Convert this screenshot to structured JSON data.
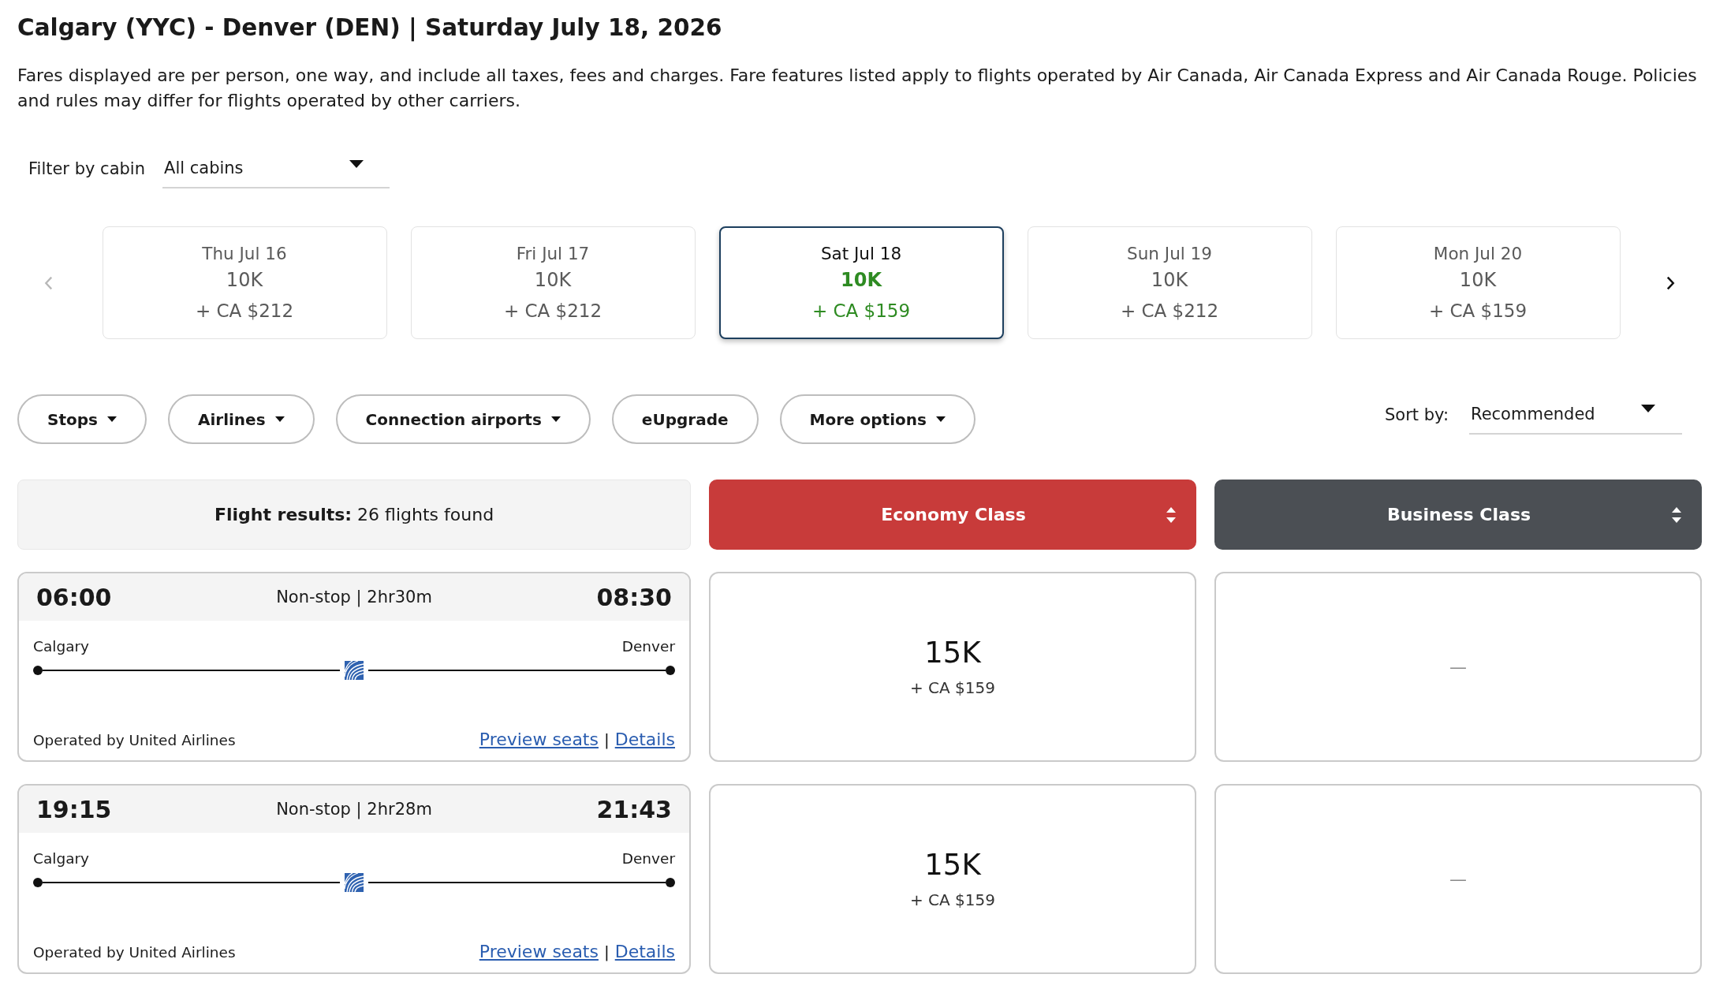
{
  "title": "Calgary (YYC) - Denver (DEN) | Saturday July 18, 2026",
  "notice": "Fares displayed are per person, one way, and include all taxes, fees and charges. Fare features listed apply to flights operated by Air Canada, Air Canada Express and Air Canada Rouge. Policies and rules may differ for flights operated by other carriers.",
  "cabin_filter": {
    "label": "Filter by cabin",
    "value": "All cabins"
  },
  "date_nav": {
    "previous": {
      "disabled": true
    },
    "next": {
      "disabled": false
    },
    "dates": [
      {
        "day": "Thu Jul 16",
        "points": "10K",
        "price": "+ CA $212",
        "selected": false
      },
      {
        "day": "Fri Jul 17",
        "points": "10K",
        "price": "+ CA $212",
        "selected": false
      },
      {
        "day": "Sat Jul 18",
        "points": "10K",
        "price": "+ CA $159",
        "selected": true
      },
      {
        "day": "Sun Jul 19",
        "points": "10K",
        "price": "+ CA $212",
        "selected": false
      },
      {
        "day": "Mon Jul 20",
        "points": "10K",
        "price": "+ CA $159",
        "selected": false
      }
    ]
  },
  "filters": [
    {
      "label": "Stops",
      "dropdown": true
    },
    {
      "label": "Airlines",
      "dropdown": true
    },
    {
      "label": "Connection airports",
      "dropdown": true
    },
    {
      "label": "eUpgrade",
      "dropdown": false
    },
    {
      "label": "More options",
      "dropdown": true
    }
  ],
  "sort": {
    "label": "Sort by:",
    "value": "Recommended"
  },
  "results_summary": "**Flight results:** 26 flights found",
  "cabins": [
    {
      "name": "Economy Class",
      "color": "#c83b3a"
    },
    {
      "name": "Business Class",
      "color": "#4b4f54"
    }
  ],
  "flights": [
    {
      "depart": "06:00",
      "summary": "Non-stop | 2hr30m",
      "arrive": "08:30",
      "origin": "Calgary",
      "destination": "Denver",
      "operator": "Operated by United Airlines",
      "links": [
        "Preview seats",
        "Details"
      ],
      "link_separator": "|",
      "fares": [
        {
          "kind": "price",
          "points": "15K",
          "price": "+ CA $159"
        },
        {
          "kind": "none",
          "text": "—"
        }
      ]
    },
    {
      "depart": "19:15",
      "summary": "Non-stop | 2hr28m",
      "arrive": "21:43",
      "origin": "Calgary",
      "destination": "Denver",
      "operator": "Operated by United Airlines",
      "links": [
        "Preview seats",
        "Details"
      ],
      "link_separator": "|",
      "fares": [
        {
          "kind": "price",
          "points": "15K",
          "price": "+ CA $159"
        },
        {
          "kind": "none",
          "text": "—"
        }
      ]
    }
  ]
}
